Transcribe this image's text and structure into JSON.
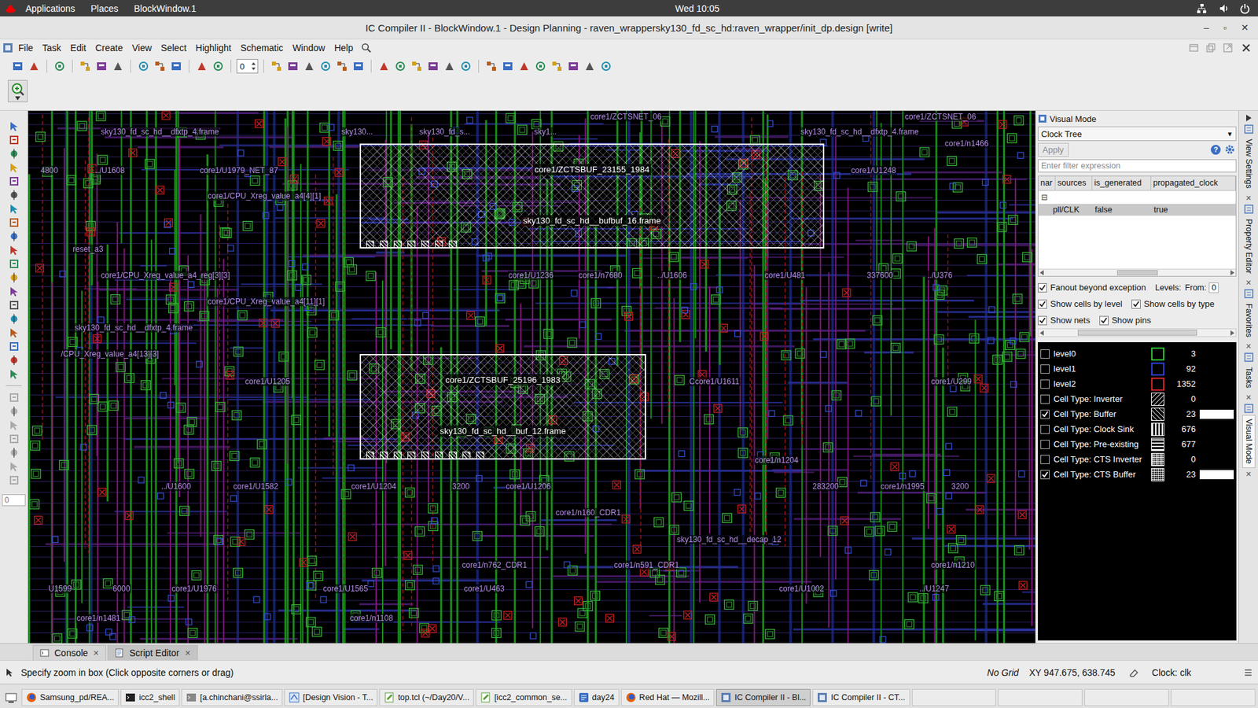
{
  "topbar": {
    "menus": [
      "Applications",
      "Places",
      "BlockWindow.1"
    ],
    "clock": "Wed 10:05"
  },
  "window": {
    "title": "IC Compiler II - BlockWindow.1 - Design Planning - raven_wrappersky130_fd_sc_hd:raven_wrapper/init_dp.design [write]",
    "controls": [
      "–",
      "▫",
      "✕"
    ]
  },
  "menu": [
    "File",
    "Task",
    "Edit",
    "Create",
    "View",
    "Select",
    "Highlight",
    "Schematic",
    "Window",
    "Help"
  ],
  "toolbar": {
    "spin_value": "0"
  },
  "left_toolbar": {
    "field_value": "0"
  },
  "canvas": {
    "labels": [
      "sky130_fd_sc_hd__dfxtp_4.frame",
      "sky130...",
      "sky130_fd_s...",
      "sky1...",
      "core1/ZCTSNET_06",
      "core1/ZCTSNET_06",
      "sky130_fd_sc_hd__dfxtp_4.frame",
      "core1/n1466",
      "4800",
      "../U1608",
      "core1/U1979_NET_87",
      "core1/U1248",
      "core1/CPU_Xreg_value_a4[4][1]",
      "reset_a3",
      "core1/CPU_Xreg_value_a4_reg[3][3]",
      "core1/U1236",
      "core1/n7680",
      "../U1606",
      "core1/U481",
      "337600",
      "../U376",
      "core1/CPU_Xreg_value_a4[11][1]",
      "sky130_fd_sc_hd__dfxtp_4.frame",
      "/CPU_Xreg_value_a4[13][3]",
      "core1/U1205",
      "Ccore1/U1611",
      "core1/U299",
      "core1/n1204",
      "../U1600",
      "core1/U1582",
      "core1/U1204",
      "3200",
      "core1/U1206",
      "283200",
      "core1/n1995",
      "3200",
      "core1/n160_CDR1",
      "sky130_fd_sc_hd__decap_12",
      "core1/n762_CDR1",
      "core1/n591_CDR1",
      "core1/n1210",
      "U1599",
      "6000",
      "core1/U1976",
      "core1/U1565",
      "core1/U463",
      "core1/U1002",
      "../U1247",
      "core1/n1481",
      "core1/n1108"
    ],
    "cells": [
      {
        "instance": "core1/ZCTSBUF_23155_1984",
        "ref": "sky130_fd_sc_hd__bufbuf_16.frame",
        "highlighted": true
      },
      {
        "instance": "core1/ZCTSBUF_25196_1983",
        "ref": "sky130_fd_sc_hd__buf_12.frame",
        "highlighted": true
      }
    ]
  },
  "panel": {
    "title": "Visual Mode",
    "mode": "Clock Tree",
    "mode_arrow": "▼",
    "apply": {
      "label": "Apply",
      "disabled": true
    },
    "help": "?",
    "filter_placeholder": "Enter filter expression",
    "table": {
      "columns": [
        "nar",
        "sources",
        "is_generated",
        "propagated_clock"
      ],
      "tree_toggle": "⊟",
      "rows": [
        {
          "name": "pll/CLK",
          "is_generated": "false",
          "propagated_clock": "true",
          "selected": true
        }
      ]
    },
    "options": [
      [
        {
          "label": "Fanout beyond exception",
          "checked": true
        }
      ],
      [
        {
          "label": "Show cells by level",
          "checked": true
        },
        {
          "label": "Show cells by type",
          "checked": true
        }
      ],
      [
        {
          "label": "Show nets",
          "checked": true
        },
        {
          "label": "Show pins",
          "checked": true
        }
      ]
    ],
    "levels_label": "Levels:",
    "from_label": "From:",
    "from_value": "0",
    "legend": [
      {
        "label": "level0",
        "checked": false,
        "kind": "level",
        "color": "#2fbf2f",
        "count": "3"
      },
      {
        "label": "level1",
        "checked": false,
        "kind": "level",
        "color": "#2c3fd6",
        "count": "92"
      },
      {
        "label": "level2",
        "checked": false,
        "kind": "level",
        "color": "#d42424",
        "count": "1352"
      },
      {
        "label": "Cell Type: Inverter",
        "checked": false,
        "kind": "backslash",
        "count": "0"
      },
      {
        "label": "Cell Type: Buffer",
        "checked": true,
        "kind": "slash",
        "count": "23"
      },
      {
        "label": "Cell Type: Clock Sink",
        "checked": false,
        "kind": "vertical",
        "count": "676"
      },
      {
        "label": "Cell Type: Pre-existing",
        "checked": false,
        "kind": "horizontal",
        "count": "677"
      },
      {
        "label": "Cell Type: CTS Inverter",
        "checked": false,
        "kind": "grid",
        "count": "0"
      },
      {
        "label": "Cell Type: CTS Buffer",
        "checked": true,
        "kind": "dots",
        "count": "23"
      }
    ]
  },
  "side_tabs": [
    {
      "label": "View Settings",
      "selected": false,
      "close": "✕"
    },
    {
      "label": "Property Editor",
      "selected": false,
      "close": "✕"
    },
    {
      "label": "Favorites",
      "selected": false,
      "close": "✕"
    },
    {
      "label": "Tasks",
      "selected": false,
      "close": "✕"
    },
    {
      "label": "Visual Mode",
      "selected": true,
      "close": "✕"
    }
  ],
  "bottom_tabs": [
    {
      "label": "Console",
      "selected": false,
      "close": "✕"
    },
    {
      "label": "Script Editor",
      "selected": true,
      "close": "✕"
    }
  ],
  "status": {
    "message": "Specify zoom in box (Click opposite corners or drag)",
    "grid": "No Grid",
    "xy": "XY 947.675, 638.745",
    "clock": "Clock: clk"
  },
  "taskbar": [
    {
      "label": "Samsung_pd/REA...",
      "selected": false,
      "kind": "firefox"
    },
    {
      "label": "icc2_shell",
      "selected": false,
      "kind": "terminal"
    },
    {
      "label": "[a.chinchani@ssirla...",
      "selected": false,
      "kind": "terminal-grey"
    },
    {
      "label": "[Design Vision - T...",
      "selected": false,
      "kind": "dv"
    },
    {
      "label": "top.tcl (~/Day20/V...",
      "selected": false,
      "kind": "editor"
    },
    {
      "label": "[icc2_common_se...",
      "selected": false,
      "kind": "editor"
    },
    {
      "label": "day24",
      "selected": false,
      "kind": "folder"
    },
    {
      "label": "Red Hat — Mozill...",
      "selected": false,
      "kind": "firefox"
    },
    {
      "label": "IC Compiler II - Bl...",
      "selected": true,
      "kind": "icc"
    },
    {
      "label": "IC Compiler II - CT...",
      "selected": false,
      "kind": "icc"
    }
  ]
}
